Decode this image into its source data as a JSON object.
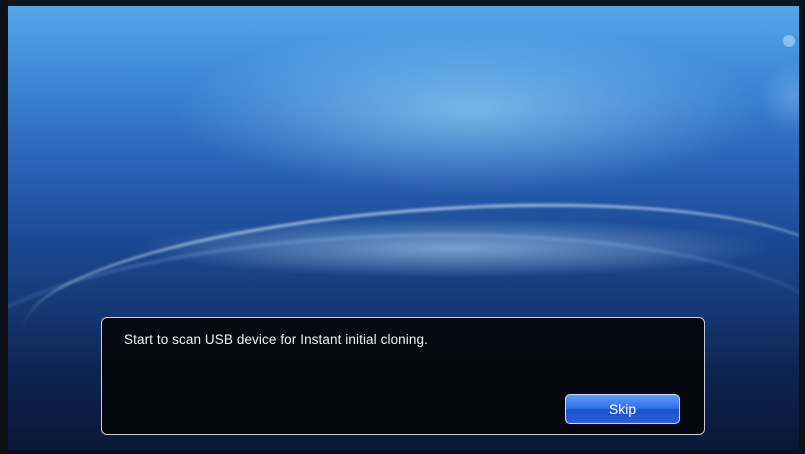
{
  "dialog": {
    "message": "Start to scan USB device for Instant initial cloning.",
    "skip_label": "Skip"
  },
  "colors": {
    "accent": "#2f6fe8",
    "background_top": "#56a9ec",
    "background_bottom": "#0a1634",
    "dialog_background": "#04060a"
  }
}
